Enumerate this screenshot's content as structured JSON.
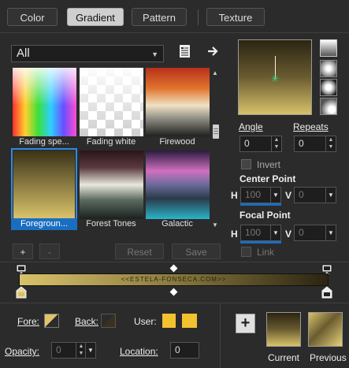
{
  "tabs": [
    {
      "label": "Color"
    },
    {
      "label": "Gradient"
    },
    {
      "label": "Pattern"
    },
    {
      "label": "Texture"
    }
  ],
  "category": {
    "selected": "All"
  },
  "gradients": [
    {
      "label": "Fading spe..."
    },
    {
      "label": "Fading white"
    },
    {
      "label": "Firewood"
    },
    {
      "label": "Foregroun..."
    },
    {
      "label": "Forest Tones"
    },
    {
      "label": "Galactic"
    }
  ],
  "buttons": {
    "add": "+",
    "remove": "-",
    "reset": "Reset",
    "save": "Save"
  },
  "angle": {
    "label": "Angle",
    "value": "0"
  },
  "repeats": {
    "label": "Repeats",
    "value": "0"
  },
  "invert": {
    "label": "Invert"
  },
  "center_point": {
    "label": "Center Point",
    "h_label": "H",
    "h_value": "100",
    "v_label": "V",
    "v_value": "0"
  },
  "focal_point": {
    "label": "Focal Point",
    "h_label": "H",
    "h_value": "100",
    "v_label": "V",
    "v_value": "0"
  },
  "link": {
    "label": "Link"
  },
  "editor": {
    "watermark": "<<ESTELA-FONSECA.COM>>"
  },
  "bottom": {
    "fore_label": "Fore:",
    "back_label": "Back:",
    "user_label": "User:",
    "opacity_label": "Opacity:",
    "opacity_value": "0",
    "location_label": "Location:",
    "location_value": "0",
    "current_label": "Current",
    "previous_label": "Previous"
  },
  "colors": {
    "accent": "#1a6ec2",
    "gold_light": "#d8c26a",
    "gold_dark": "#2a2412",
    "user_swatch": "#f2c230"
  }
}
